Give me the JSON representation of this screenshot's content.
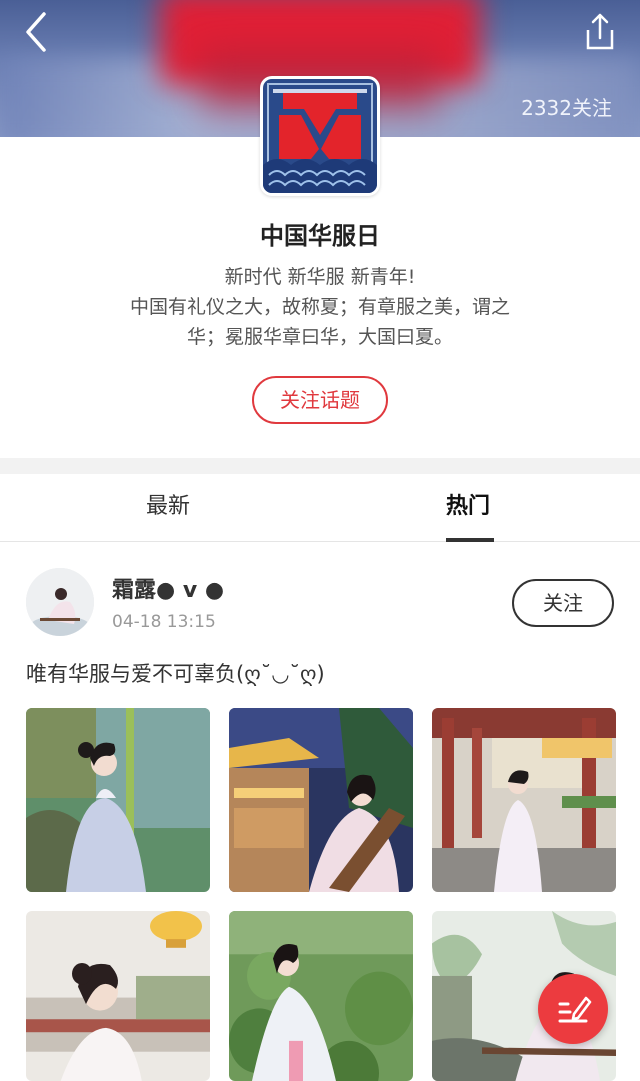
{
  "header": {
    "follow_count": "2332关注",
    "back_icon": "chevron-left-icon",
    "share_icon": "share-icon"
  },
  "topic": {
    "title": "中国华服日",
    "desc_line1": "新时代 新华服  新青年!",
    "desc_line2": "中国有礼仪之大，故称夏；有章服之美，谓之",
    "desc_line3": "华；冕服华章曰华，大国曰夏。",
    "follow_label": "关注话题",
    "accent_color": "#e0393e"
  },
  "tabs": [
    {
      "label": "最新"
    },
    {
      "label": "热门"
    }
  ],
  "post": {
    "user_name": "霜露● v ●",
    "time": "04-18 13:15",
    "follow_label": "关注",
    "text": "唯有华服与爱不可辜负(ღ˘◡˘ღ)"
  },
  "fab": {
    "icon": "compose-icon",
    "color": "#ec3b3f"
  }
}
